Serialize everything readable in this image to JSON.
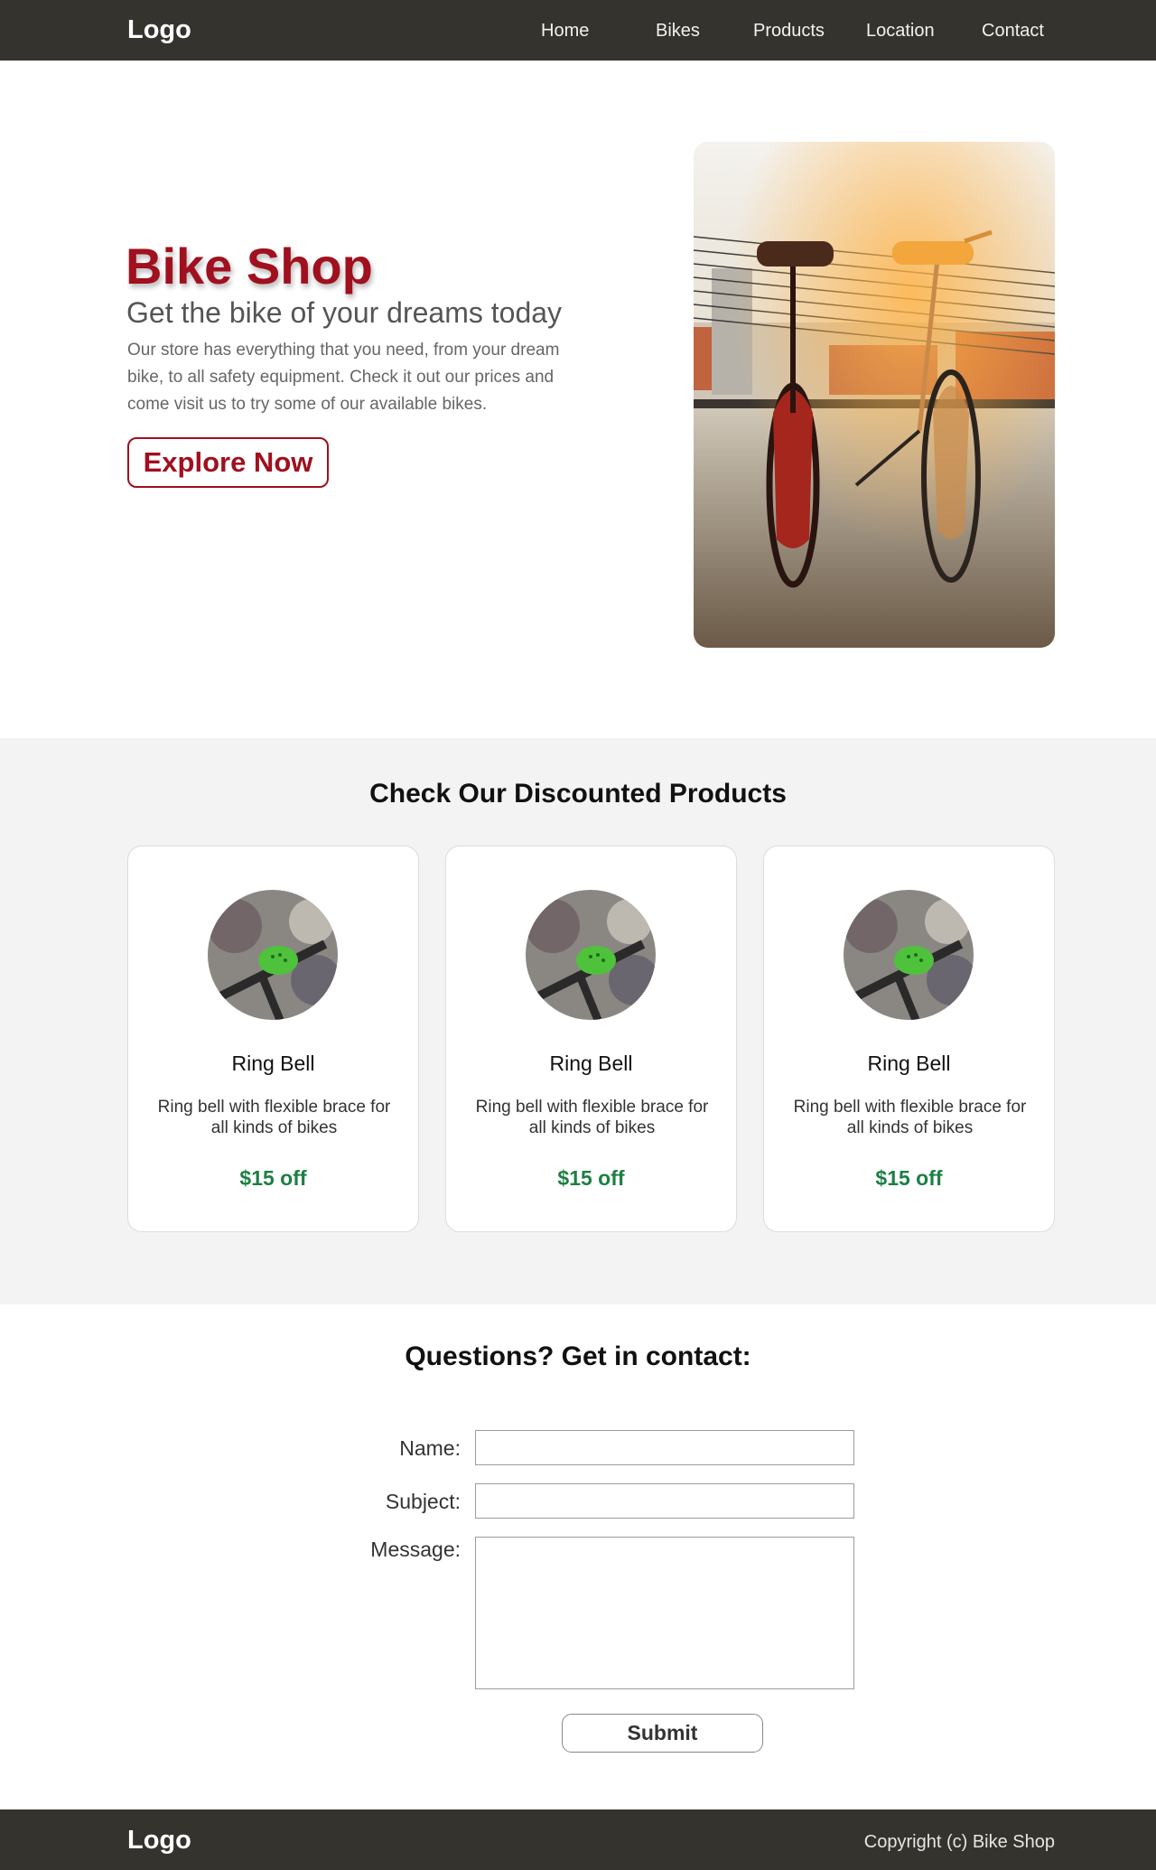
{
  "header": {
    "logo": "Logo",
    "nav": [
      "Home",
      "Bikes",
      "Products",
      "Location",
      "Contact"
    ]
  },
  "hero": {
    "title": "Bike Shop",
    "subtitle": "Get the bike of your dreams today",
    "text": "Our store has everything that you need, from your dream bike, to all safety equipment. Check it out our prices and come visit us to try some of our available bikes.",
    "cta": "Explore Now",
    "image": "two-bicycles-photo"
  },
  "products": {
    "title": "Check Our Discounted Products",
    "items": [
      {
        "name": "Ring Bell",
        "description": "Ring bell with flexible brace for all kinds of bikes",
        "price": "$15 off",
        "image": "green-ring-bell-photo"
      },
      {
        "name": "Ring Bell",
        "description": "Ring bell with flexible brace for all kinds of bikes",
        "price": "$15 off",
        "image": "green-ring-bell-photo"
      },
      {
        "name": "Ring Bell",
        "description": "Ring bell with flexible brace for all kinds of bikes",
        "price": "$15 off",
        "image": "green-ring-bell-photo"
      }
    ]
  },
  "contact": {
    "title": "Questions? Get in contact:",
    "name_label": "Name:",
    "name_value": "",
    "subject_label": "Subject:",
    "subject_value": "",
    "message_label": "Message:",
    "message_value": "",
    "submit": "Submit"
  },
  "footer": {
    "logo": "Logo",
    "copyright": "Copyright (c) Bike Shop"
  },
  "colors": {
    "header_bg": "#34332d",
    "accent": "#a0101e",
    "price": "#1d7f44",
    "section_bg": "#f3f3f3"
  }
}
